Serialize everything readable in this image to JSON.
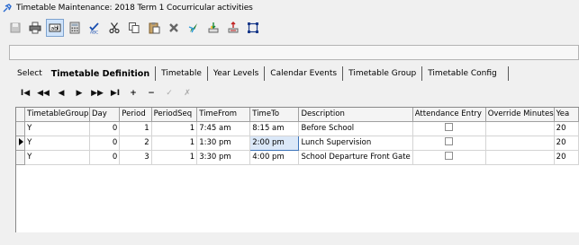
{
  "window": {
    "title": "Timetable Maintenance:  2018 Term 1 Cocurricular activities",
    "icon": "pin-icon"
  },
  "toolbar": [
    {
      "name": "save-icon",
      "active": false
    },
    {
      "name": "print-icon",
      "active": false
    },
    {
      "name": "text-field-icon",
      "active": true
    },
    {
      "name": "calculator-icon",
      "active": false
    },
    {
      "name": "spellcheck-icon",
      "active": false
    },
    {
      "name": "cut-icon",
      "active": false
    },
    {
      "name": "copy-icon",
      "active": false
    },
    {
      "name": "paste-icon",
      "active": false
    },
    {
      "name": "delete-icon",
      "active": false
    },
    {
      "name": "arrow-pointer-icon",
      "active": false
    },
    {
      "name": "transfer-icon",
      "active": false
    },
    {
      "name": "export-icon",
      "active": false
    },
    {
      "name": "select-area-icon",
      "active": false
    }
  ],
  "tabs": {
    "select": "Select",
    "items": [
      "Timetable Definition",
      "Timetable",
      "Year Levels",
      "Calendar Events",
      "Timetable Group",
      "Timetable Config"
    ],
    "active_index": 0
  },
  "navigator": {
    "first": "I◀",
    "prev_page": "◀◀",
    "prev": "◀",
    "next": "▶",
    "next_page": "▶▶",
    "last": "▶I",
    "insert": "+",
    "delete": "−",
    "post": "✓",
    "cancel": "✗"
  },
  "grid": {
    "columns": [
      "TimetableGroup",
      "Day",
      "Period",
      "PeriodSeq",
      "TimeFrom",
      "TimeTo",
      "Description",
      "Attendance Entry",
      "Override Minutes",
      "Yea"
    ],
    "rows": [
      {
        "group": "Y",
        "day": "0",
        "period": "1",
        "seq": "1",
        "from": "7:45 am",
        "to": "8:15 am",
        "desc": "Before School",
        "attendance": false,
        "override": "",
        "year": "20",
        "current": false
      },
      {
        "group": "Y",
        "day": "0",
        "period": "2",
        "seq": "1",
        "from": "1:30 pm",
        "to": "2:00 pm",
        "desc": "Lunch Supervision",
        "attendance": false,
        "override": "",
        "year": "20",
        "current": true
      },
      {
        "group": "Y",
        "day": "0",
        "period": "3",
        "seq": "1",
        "from": "3:30 pm",
        "to": "4:00 pm",
        "desc": "School Departure Front Gate",
        "attendance": false,
        "override": "",
        "year": "20",
        "current": false
      }
    ]
  }
}
